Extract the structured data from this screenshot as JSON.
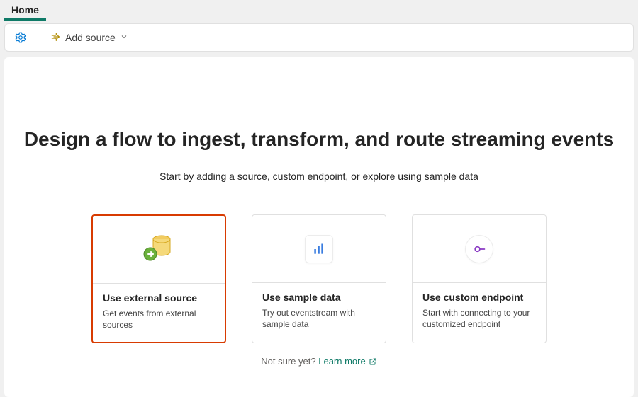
{
  "tabs": {
    "home": "Home"
  },
  "toolbar": {
    "add_source": "Add source"
  },
  "hero": {
    "title": "Design a flow to ingest, transform, and route streaming events",
    "subtitle": "Start by adding a source, custom endpoint, or explore using sample data"
  },
  "cards": [
    {
      "title": "Use external source",
      "desc": "Get events from external sources",
      "highlighted": true
    },
    {
      "title": "Use sample data",
      "desc": "Try out eventstream with sample data",
      "highlighted": false
    },
    {
      "title": "Use custom endpoint",
      "desc": "Start with connecting to your customized endpoint",
      "highlighted": false
    }
  ],
  "footer": {
    "not_sure": "Not sure yet?",
    "learn_more": "Learn more"
  }
}
